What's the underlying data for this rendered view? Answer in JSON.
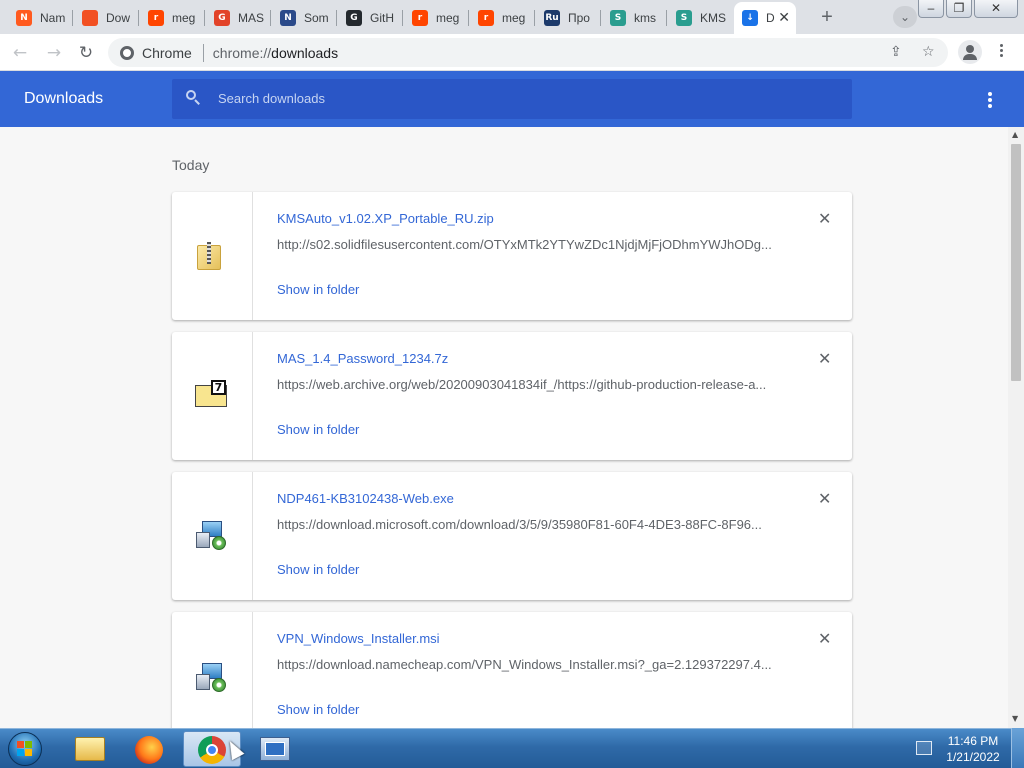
{
  "browser": {
    "tabs": [
      {
        "title": "Nam",
        "favicon_color": "#ff5a1f",
        "favicon_glyph": "N",
        "icon": "n-logo-icon"
      },
      {
        "title": "Dow",
        "favicon_color": "#f25022",
        "favicon_glyph": "",
        "icon": "microsoft-logo-icon"
      },
      {
        "title": "meg",
        "favicon_color": "#ff4500",
        "favicon_glyph": "r",
        "icon": "reddit-icon"
      },
      {
        "title": "MAS",
        "favicon_color": "#e24329",
        "favicon_glyph": "G",
        "icon": "gitlab-icon"
      },
      {
        "title": "Som",
        "favicon_color": "#2b4a8a",
        "favicon_glyph": "N",
        "icon": "n-blue-icon"
      },
      {
        "title": "GitH",
        "favicon_color": "#24292e",
        "favicon_glyph": "G",
        "icon": "github-icon"
      },
      {
        "title": "meg",
        "favicon_color": "#ff4500",
        "favicon_glyph": "r",
        "icon": "reddit-icon"
      },
      {
        "title": "meg",
        "favicon_color": "#ff4500",
        "favicon_glyph": "r",
        "icon": "reddit-icon"
      },
      {
        "title": "Про",
        "favicon_color": "#1c3a6b",
        "favicon_glyph": "Ru",
        "icon": "ru-board-icon"
      },
      {
        "title": "kms",
        "favicon_color": "#2a9d8f",
        "favicon_glyph": "S",
        "icon": "solidfiles-icon"
      },
      {
        "title": "KMS",
        "favicon_color": "#2a9d8f",
        "favicon_glyph": "S",
        "icon": "solidfiles-icon"
      },
      {
        "title": "D",
        "favicon_color": "#1a73e8",
        "favicon_glyph": "↓",
        "icon": "download-icon"
      }
    ],
    "new_tab_label": "+",
    "tab_search_label": "⌄",
    "omnibox": {
      "chip_label": "Chrome",
      "url_scheme": "chrome://",
      "url_path": "downloads"
    }
  },
  "downloads_page": {
    "title": "Downloads",
    "search_placeholder": "Search downloads",
    "section_label": "Today",
    "items": [
      {
        "filename": "KMSAuto_v1.02.XP_Portable_RU.zip",
        "url": "http://s02.solidfilesusercontent.com/OTYxMTk2YTYwZDc1NjdjMjFjODhmYWJhODg...",
        "action": "Show in folder",
        "icon": "zip-folder-icon"
      },
      {
        "filename": "MAS_1.4_Password_1234.7z",
        "url": "https://web.archive.org/web/20200903041834if_/https://github-production-release-a...",
        "action": "Show in folder",
        "icon": "7z-archive-icon"
      },
      {
        "filename": "NDP461-KB3102438-Web.exe",
        "url": "https://download.microsoft.com/download/3/5/9/35980F81-60F4-4DE3-88FC-8F96...",
        "action": "Show in folder",
        "icon": "installer-exe-icon"
      },
      {
        "filename": "VPN_Windows_Installer.msi",
        "url": "https://download.namecheap.com/VPN_Windows_Installer.msi?_ga=2.129372297.4...",
        "action": "Show in folder",
        "icon": "installer-msi-icon"
      }
    ]
  },
  "taskbar": {
    "clock_time": "11:46 PM",
    "clock_date": "1/21/2022"
  },
  "colors": {
    "header_blue": "#3367d6",
    "search_blue": "#2a56c6",
    "link_blue": "#3367d6"
  }
}
